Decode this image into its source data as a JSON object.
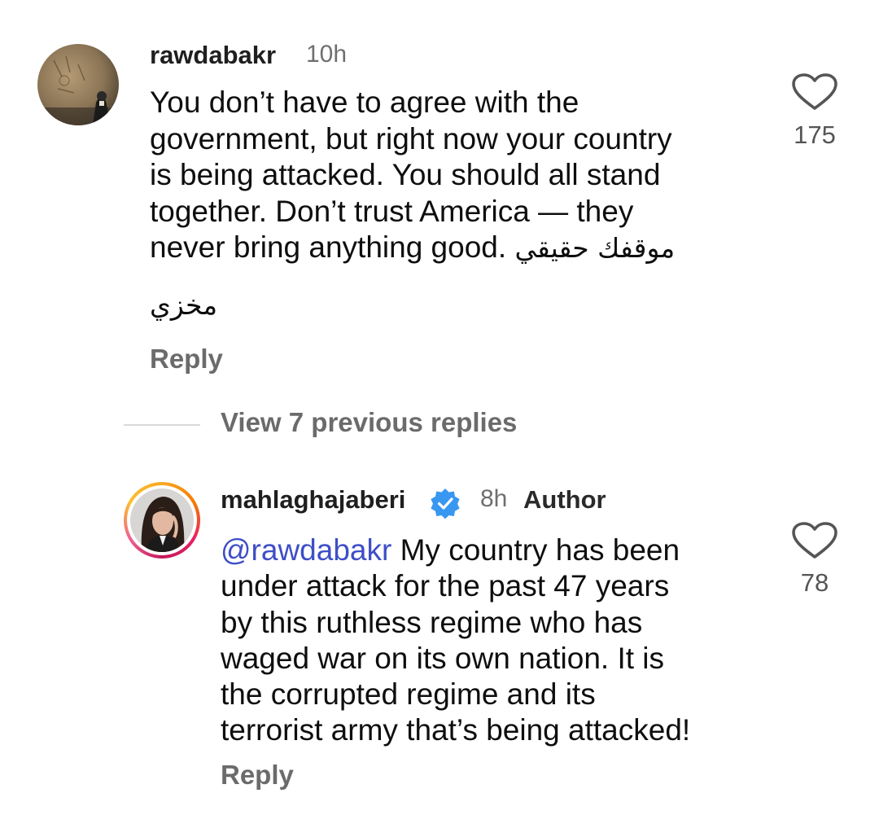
{
  "comments": [
    {
      "username": "rawdabakr",
      "time": "10h",
      "lines": [
        "You don’t have to agree with the",
        "government, but right now your country",
        "is being attacked. You should all stand",
        "together. Don’t trust America — they",
        "never bring anything good."
      ],
      "arabic_inline": "موقفك حقيقي",
      "arabic_extra": "مخزي",
      "reply_label": "Reply",
      "like_count": "175",
      "like_icon": "heart-outline-icon"
    },
    {
      "username": "mahlaghajaberi",
      "verified_icon": "verified-badge-icon",
      "time": "8h",
      "author_badge": "Author",
      "mention": "@rawdabakr",
      "lines": [
        "My country has been",
        "under attack for the past 47 years",
        "by this ruthless regime who has",
        "waged war on its own nation. It is",
        "the corrupted regime and its",
        "terrorist army that’s being attacked!"
      ],
      "reply_label": "Reply",
      "like_count": "78",
      "like_icon": "heart-outline-icon"
    }
  ],
  "view_replies_label": "View 7 previous replies",
  "colors": {
    "mention": "#3e4ec7",
    "verified": "#3897f0",
    "muted_text": "#6b6b6b"
  }
}
